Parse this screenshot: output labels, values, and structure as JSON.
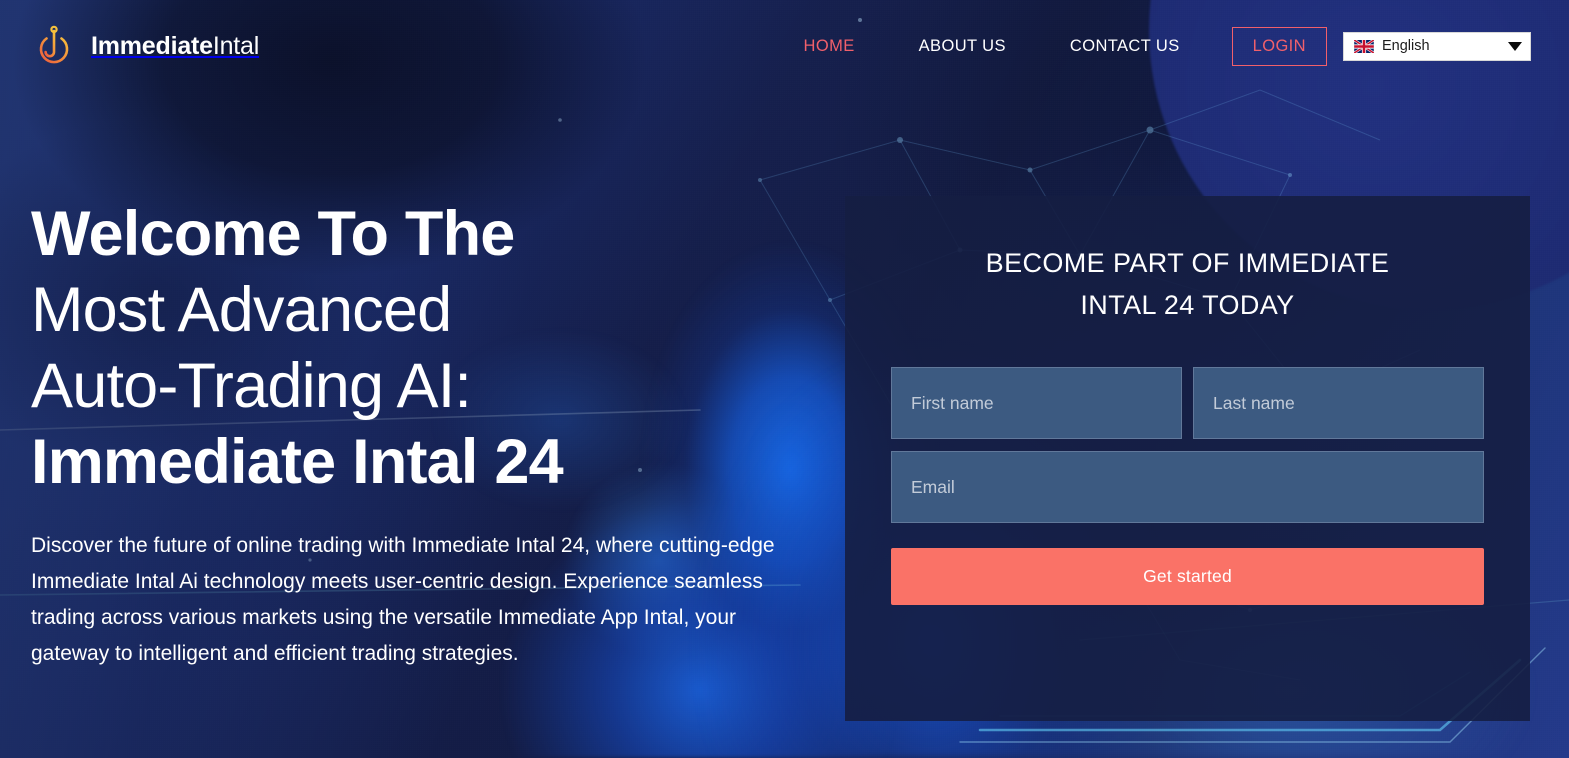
{
  "brand": {
    "name_bold": "Immediate",
    "name_light": "Intal",
    "logo_icon": "power-hook-logo-icon",
    "accent_color": "#ef7a3d"
  },
  "header": {
    "nav": [
      {
        "label": "HOME",
        "active": true
      },
      {
        "label": "ABOUT US",
        "active": false
      },
      {
        "label": "CONTACT US",
        "active": false
      }
    ],
    "login_label": "LOGIN",
    "language": {
      "selected": "English",
      "flag_icon": "uk-flag-icon",
      "caret_icon": "chevron-down-icon"
    },
    "link_color": "#ffffff",
    "active_color": "#f1606b"
  },
  "hero": {
    "title_lines": [
      {
        "text": "Welcome To The",
        "weight": "bold"
      },
      {
        "text": "Most Advanced",
        "weight": "light"
      },
      {
        "text": "Auto-Trading AI:",
        "weight": "light"
      },
      {
        "text": "Immediate Intal 24",
        "weight": "bold"
      }
    ],
    "paragraph": "Discover the future of online trading with Immediate Intal 24, where cutting-edge Immediate Intal Ai technology meets user-centric design. Experience seamless trading across various markets using the versatile Immediate App Intal, your gateway to intelligent and efficient trading strategies."
  },
  "signup": {
    "title_lines": [
      "BECOME PART OF IMMEDIATE",
      "INTAL 24 TODAY"
    ],
    "fields": {
      "first_name_placeholder": "First name",
      "first_name_value": "",
      "last_name_placeholder": "Last name",
      "last_name_value": "",
      "email_placeholder": "Email",
      "email_value": ""
    },
    "submit_label": "Get started",
    "submit_color": "#fa7267",
    "card_color": "#151e42",
    "input_color": "#3c5a81"
  }
}
